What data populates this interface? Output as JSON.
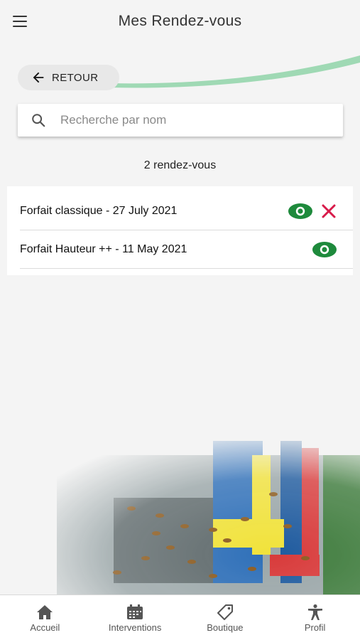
{
  "header": {
    "title": "Mes Rendez-vous"
  },
  "back": {
    "label": "RETOUR"
  },
  "search": {
    "placeholder": "Recherche par nom",
    "value": ""
  },
  "count": "2 rendez-vous",
  "appointments": [
    {
      "label": "Forfait classique - 27 July 2021",
      "actions": [
        "eye-icon",
        "close-icon"
      ]
    },
    {
      "label": "Forfait Hauteur ++ - 11 May 2021",
      "actions": [
        "eye-icon"
      ]
    }
  ],
  "nav": [
    {
      "label": "Accueil",
      "icon": "home-icon"
    },
    {
      "label": "Interventions",
      "icon": "calendar-icon"
    },
    {
      "label": "Boutique",
      "icon": "tag-icon"
    },
    {
      "label": "Profil",
      "icon": "person-icon"
    }
  ],
  "colors": {
    "accent_green": "#1e8a3c",
    "delete_red": "#d81b4a",
    "swoosh_green": "#8fd3a8"
  }
}
